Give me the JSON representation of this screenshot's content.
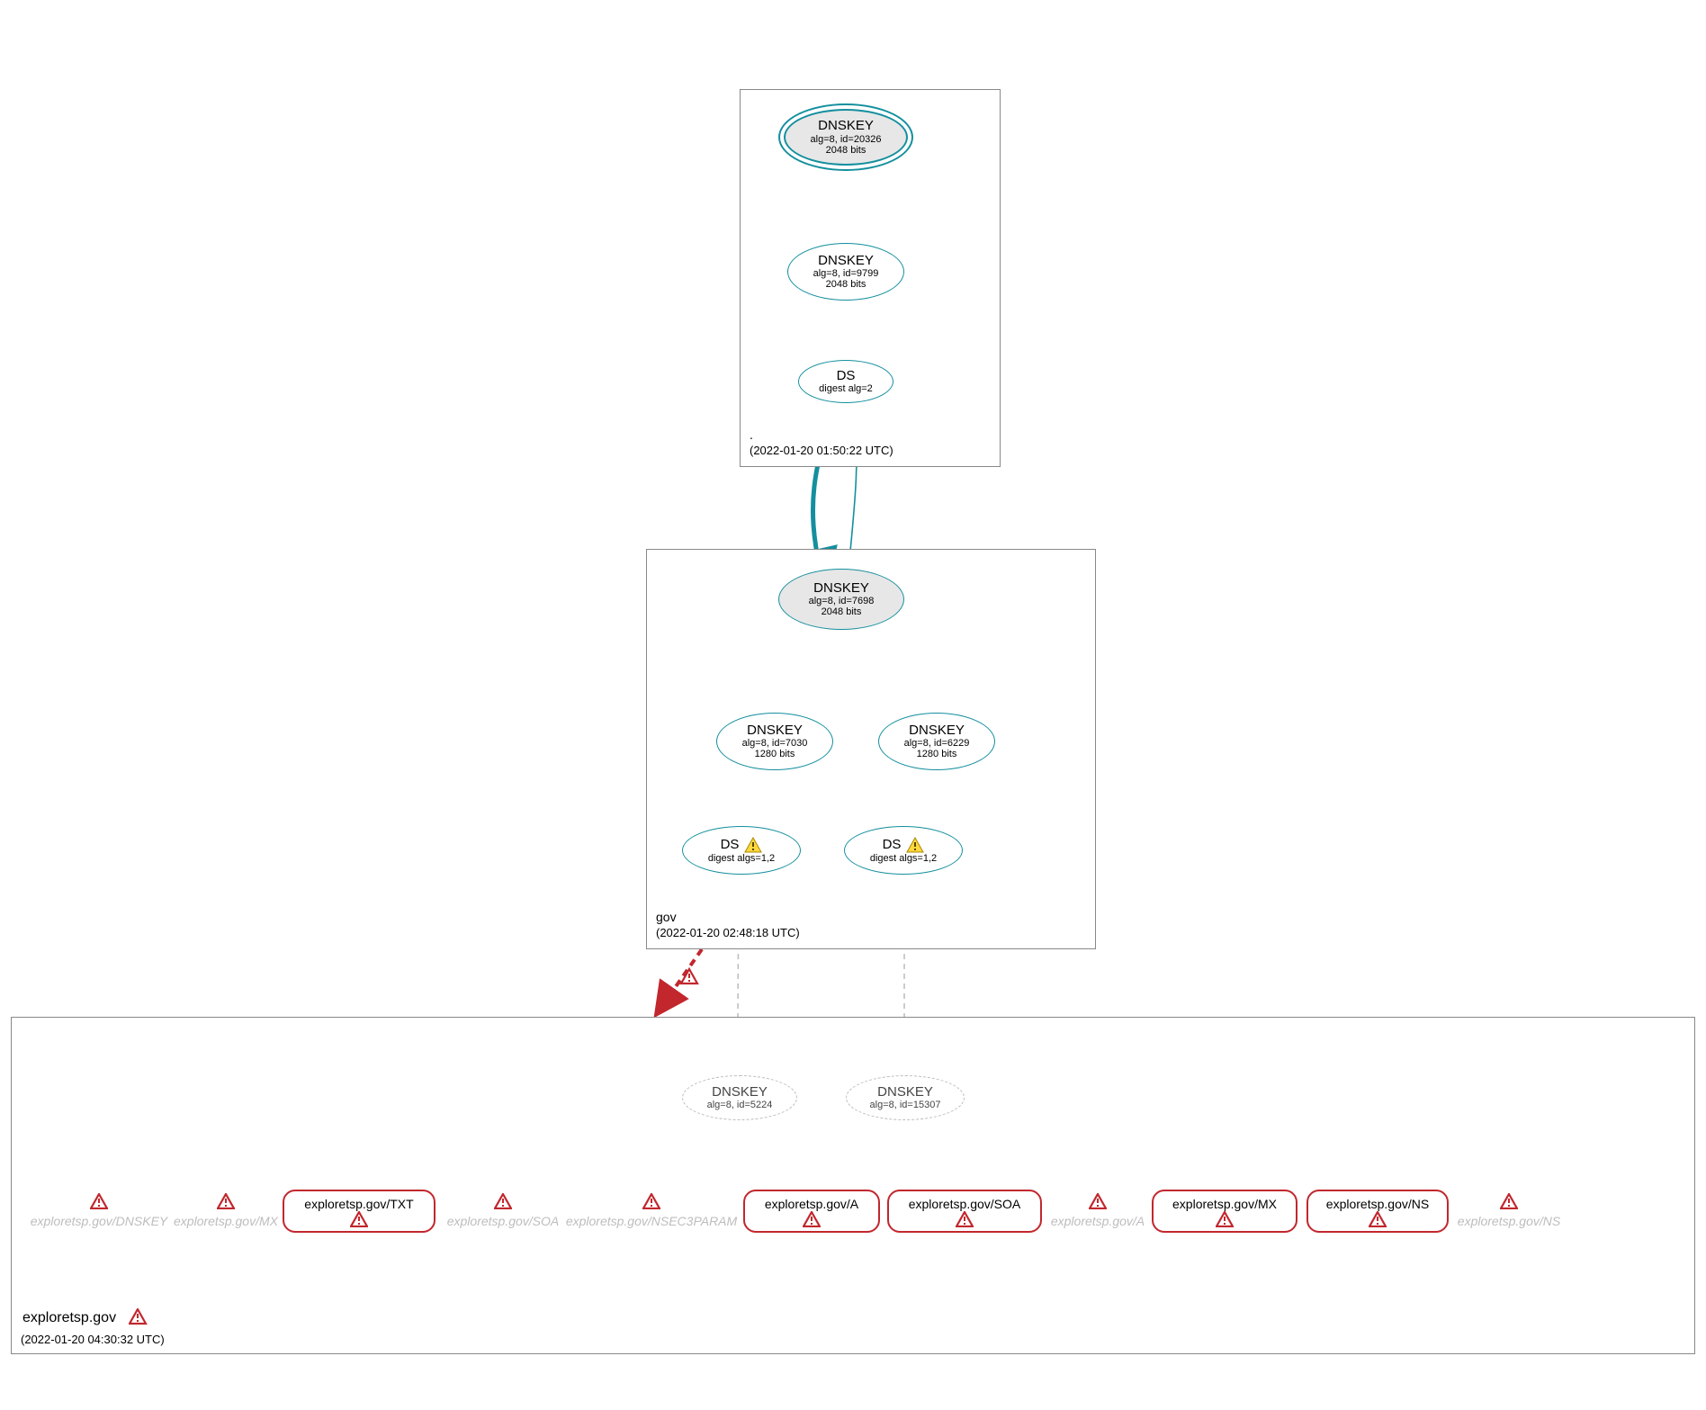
{
  "colors": {
    "teal": "#148f9e",
    "error": "#c1272d",
    "gray": "#bcbcbc",
    "faded_text": "#bdbdbd",
    "ksk_fill": "#e7e7e7"
  },
  "zones": [
    {
      "id": "root",
      "name": ".",
      "timestamp": "(2022-01-20 01:50:22 UTC)",
      "has_warning": false
    },
    {
      "id": "gov",
      "name": "gov",
      "timestamp": "(2022-01-20 02:48:18 UTC)",
      "has_warning": false
    },
    {
      "id": "exploretsp",
      "name": "exploretsp.gov",
      "timestamp": "(2022-01-20 04:30:32 UTC)",
      "has_warning": true
    }
  ],
  "nodes": {
    "root_ksk": {
      "title": "DNSKEY",
      "sub1": "alg=8, id=20326",
      "sub2": "2048 bits"
    },
    "root_zsk": {
      "title": "DNSKEY",
      "sub1": "alg=8, id=9799",
      "sub2": "2048 bits"
    },
    "root_ds": {
      "title": "DS",
      "sub1": "digest alg=2"
    },
    "gov_ksk": {
      "title": "DNSKEY",
      "sub1": "alg=8, id=7698",
      "sub2": "2048 bits"
    },
    "gov_zsk1": {
      "title": "DNSKEY",
      "sub1": "alg=8, id=7030",
      "sub2": "1280 bits"
    },
    "gov_zsk2": {
      "title": "DNSKEY",
      "sub1": "alg=8, id=6229",
      "sub2": "1280 bits"
    },
    "gov_ds1": {
      "title": "DS",
      "sub1": "digest algs=1,2",
      "warn": true
    },
    "gov_ds2": {
      "title": "DS",
      "sub1": "digest algs=1,2",
      "warn": true
    },
    "exp_key1": {
      "title": "DNSKEY",
      "sub1": "alg=8, id=5224"
    },
    "exp_key2": {
      "title": "DNSKEY",
      "sub1": "alg=8, id=15307"
    }
  },
  "rr_boxes": [
    {
      "label": "exploretsp.gov/TXT"
    },
    {
      "label": "exploretsp.gov/A"
    },
    {
      "label": "exploretsp.gov/SOA"
    },
    {
      "label": "exploretsp.gov/MX"
    },
    {
      "label": "exploretsp.gov/NS"
    }
  ],
  "faded_rr": [
    {
      "label": "exploretsp.gov/DNSKEY"
    },
    {
      "label": "exploretsp.gov/MX"
    },
    {
      "label": "exploretsp.gov/SOA"
    },
    {
      "label": "exploretsp.gov/NSEC3PARAM"
    },
    {
      "label": "exploretsp.gov/A"
    },
    {
      "label": "exploretsp.gov/NS"
    }
  ],
  "edges": [
    {
      "from": "root_ksk",
      "to": "root_ksk",
      "type": "self-teal"
    },
    {
      "from": "root_ksk",
      "to": "root_zsk",
      "type": "teal"
    },
    {
      "from": "root_zsk",
      "to": "root_ds",
      "type": "teal"
    },
    {
      "from": "root_ds",
      "to": "gov_ksk",
      "type": "teal-thick",
      "crosses_zone": true
    },
    {
      "from": "gov_ksk",
      "to": "gov_ksk",
      "type": "self-teal"
    },
    {
      "from": "gov_ksk",
      "to": "gov_zsk1",
      "type": "teal"
    },
    {
      "from": "gov_ksk",
      "to": "gov_zsk2",
      "type": "teal"
    },
    {
      "from": "gov_zsk1",
      "to": "gov_ds1",
      "type": "teal"
    },
    {
      "from": "gov_zsk1",
      "to": "gov_ds2",
      "type": "teal"
    },
    {
      "from": "gov_zone",
      "to": "exp_zone",
      "type": "red-dashed",
      "crosses_zone": true,
      "warn": true
    },
    {
      "from": "gov_ds1",
      "to": "exp_key1",
      "type": "gray-dashed",
      "crosses_zone": true
    },
    {
      "from": "gov_ds2",
      "to": "exp_key2",
      "type": "gray-dashed",
      "crosses_zone": true
    }
  ]
}
